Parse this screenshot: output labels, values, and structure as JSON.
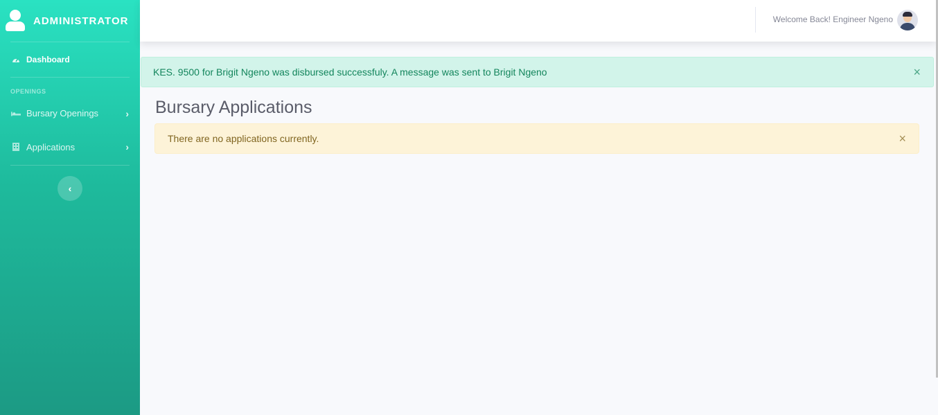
{
  "sidebar": {
    "brand": "ADMINISTRATOR",
    "dashboard_label": "Dashboard",
    "section_heading": "OPENINGS",
    "items": [
      {
        "label": "Bursary Openings",
        "icon": "bed-icon"
      },
      {
        "label": "Applications",
        "icon": "building-icon"
      }
    ],
    "toggle_icon": "chevron-left-icon"
  },
  "topbar": {
    "welcome": "Welcome Back! Engineer Ngeno"
  },
  "alerts": {
    "success": "KES. 9500 for Brigit Ngeno was disbursed successfuly. A message was sent to Brigit Ngeno",
    "close_glyph": "×"
  },
  "main": {
    "title": "Bursary Applications",
    "empty_message": "There are no applications currently."
  },
  "colors": {
    "sidebar_top": "#2ae2c2",
    "sidebar_bottom": "#1c9a84",
    "success_bg": "#d2f4ea",
    "warning_bg": "#fdf3d8"
  }
}
